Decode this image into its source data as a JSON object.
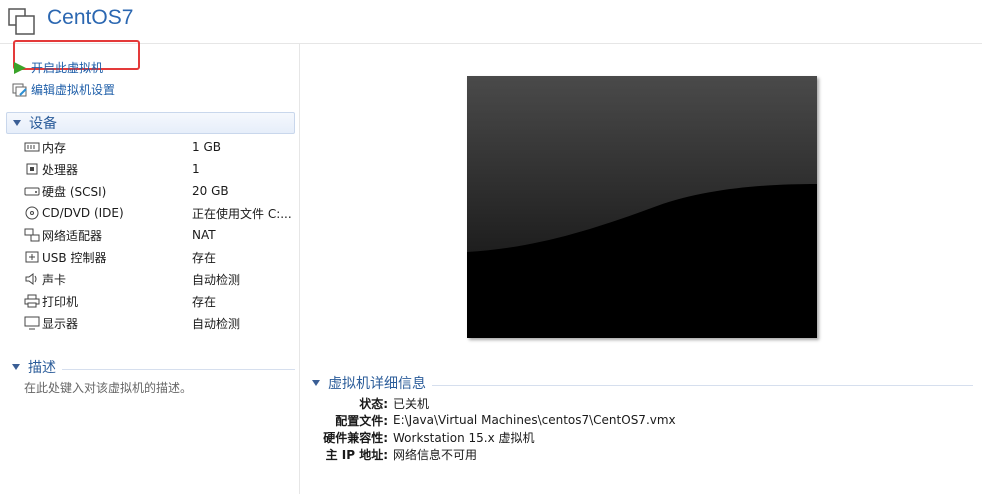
{
  "window": {
    "title": "CentOS7"
  },
  "actions": {
    "power_on": "开启此虚拟机",
    "edit_settings": "编辑虚拟机设置"
  },
  "devices": {
    "header": "设备",
    "items": [
      {
        "icon": "memory-icon",
        "name": "内存",
        "value": "1 GB"
      },
      {
        "icon": "cpu-icon",
        "name": "处理器",
        "value": "1"
      },
      {
        "icon": "harddisk-icon",
        "name": "硬盘 (SCSI)",
        "value": "20 GB"
      },
      {
        "icon": "cd-dvd-icon",
        "name": "CD/DVD (IDE)",
        "value": "正在使用文件 C:..."
      },
      {
        "icon": "network-icon",
        "name": "网络适配器",
        "value": "NAT"
      },
      {
        "icon": "usb-icon",
        "name": "USB 控制器",
        "value": "存在"
      },
      {
        "icon": "sound-icon",
        "name": "声卡",
        "value": "自动检测"
      },
      {
        "icon": "printer-icon",
        "name": "打印机",
        "value": "存在"
      },
      {
        "icon": "display-icon",
        "name": "显示器",
        "value": "自动检测"
      }
    ]
  },
  "description": {
    "header": "描述",
    "placeholder": "在此处键入对该虚拟机的描述。"
  },
  "details": {
    "header": "虚拟机详细信息",
    "rows": [
      {
        "key": "状态:",
        "value": "已关机"
      },
      {
        "key": "配置文件:",
        "value": "E:\\Java\\Virtual Machines\\centos7\\CentOS7.vmx"
      },
      {
        "key": "硬件兼容性:",
        "value": "Workstation 15.x 虚拟机"
      },
      {
        "key": "主 IP 地址:",
        "value": "网络信息不可用"
      }
    ]
  },
  "colors": {
    "accent": "#2b67b1",
    "highlight_box": "#e43a3a",
    "power_icon": "#3aa329"
  }
}
